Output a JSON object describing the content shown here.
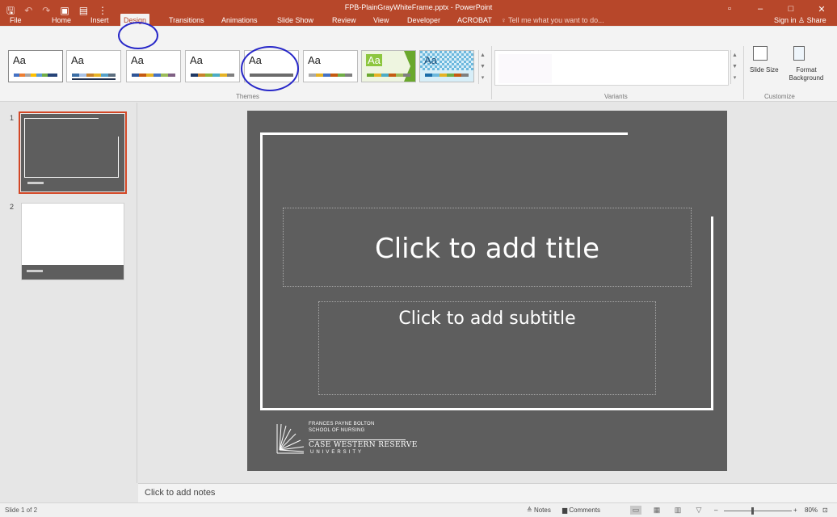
{
  "window": {
    "title": "FPB-PlainGrayWhiteFrame.pptx - PowerPoint",
    "controls": [
      "▫",
      "–",
      "□",
      "✕"
    ]
  },
  "qat": {
    "save": "🖫",
    "undo": "↶",
    "redo": "↷",
    "present": "▣",
    "touch": "▤",
    "more": "⋮"
  },
  "tabs": [
    "File",
    "Home",
    "Insert",
    "Design",
    "Transitions",
    "Animations",
    "Slide Show",
    "Review",
    "View",
    "Developer",
    "ACROBAT"
  ],
  "tell_me": "Tell me what you want to do...",
  "account": {
    "signin": "Sign in",
    "share": "Share"
  },
  "ribbon": {
    "themes_label": "Themes",
    "variants_label": "Variants",
    "customize_label": "Customize",
    "theme_sample": "Aa",
    "slide_size": "Slide Size",
    "format_background": "Format Background",
    "theme_colors": [
      "#3b6ea5",
      "#a9c2e6",
      "#c9812b",
      "#e6b325",
      "#55a0c8",
      "#5d6f80",
      "#9bbb59",
      "#4bacc6"
    ]
  },
  "slides_panel": {
    "slide_numbers": [
      "1",
      "2"
    ]
  },
  "slide": {
    "title_placeholder": "Click to add title",
    "subtitle_placeholder": "Click to add subtitle",
    "logo_line1": "FRANCES PAYNE BOLTON",
    "logo_line2": "SCHOOL OF NURSING",
    "logo_line3": "CASE WESTERN RESERVE",
    "logo_line4": "UNIVERSITY"
  },
  "notes_placeholder": "Click to add notes",
  "status": {
    "slide_info": "Slide 1 of 2",
    "notes": "Notes",
    "comments": "Comments",
    "zoom": "80%"
  }
}
